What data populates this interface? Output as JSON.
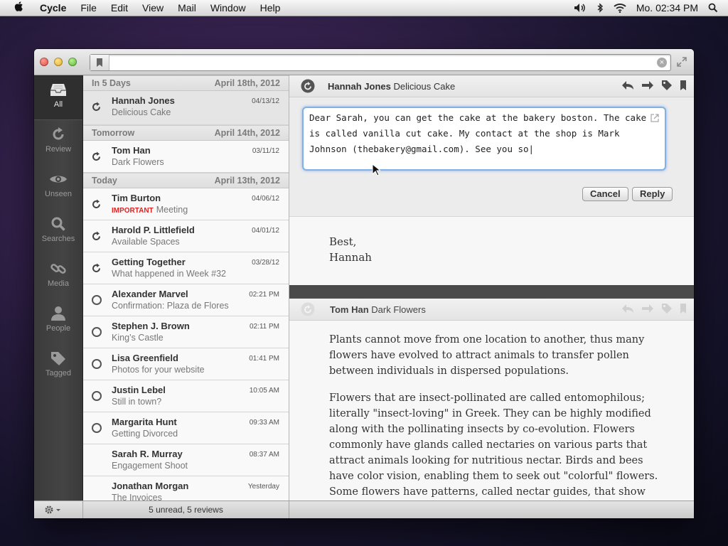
{
  "menubar": {
    "app": "Cycle",
    "items": [
      "File",
      "Edit",
      "View",
      "Mail",
      "Window",
      "Help"
    ],
    "clock": "Mo. 02:34 PM"
  },
  "sidebar": {
    "items": [
      {
        "label": "All",
        "icon": "inbox-icon"
      },
      {
        "label": "Review",
        "icon": "refresh-icon"
      },
      {
        "label": "Unseen",
        "icon": "eye-icon"
      },
      {
        "label": "Searches",
        "icon": "search-icon"
      },
      {
        "label": "Media",
        "icon": "link-icon"
      },
      {
        "label": "People",
        "icon": "person-icon"
      },
      {
        "label": "Tagged",
        "icon": "tag-icon"
      }
    ]
  },
  "list": {
    "groups": [
      {
        "label": "In 5 Days",
        "date": "April 18th, 2012"
      },
      {
        "label": "Tomorrow",
        "date": "April 14th, 2012"
      },
      {
        "label": "Today",
        "date": "April 13th, 2012"
      }
    ],
    "rows": [
      {
        "name": "Hannah Jones",
        "subject": "Delicious Cake",
        "date": "04/13/12"
      },
      {
        "name": "Tom Han",
        "subject": "Dark Flowers",
        "date": "03/11/12"
      },
      {
        "name": "Tim Burton",
        "important": "IMPORTANT",
        "subject": "Meeting",
        "date": "04/06/12"
      },
      {
        "name": "Harold P. Littlefield",
        "subject": "Available Spaces",
        "date": "04/01/12"
      },
      {
        "name": "Getting Together",
        "subject": "What happened in Week #32",
        "date": "03/28/12"
      },
      {
        "name": "Alexander Marvel",
        "subject": "Confirmation: Plaza de Flores",
        "date": "02:21 PM"
      },
      {
        "name": "Stephen J. Brown",
        "subject": "King’s Castle",
        "date": "02:11 PM"
      },
      {
        "name": "Lisa Greenfield",
        "subject": "Photos for your website",
        "date": "01:41 PM"
      },
      {
        "name": "Justin Lebel",
        "subject": "Still in town?",
        "date": "10:05 AM"
      },
      {
        "name": "Margarita Hunt",
        "subject": "Getting Divorced",
        "date": "09:33 AM"
      },
      {
        "name": "Sarah R. Murray",
        "subject": "Engagement Shoot",
        "date": "08:37 AM"
      },
      {
        "name": "Jonathan Morgan",
        "subject": "The Invoices",
        "date": "Yesterday"
      }
    ]
  },
  "message1": {
    "sender": "Hannah Jones",
    "subject": "Delicious Cake",
    "reply_text": "Dear Sarah, you can get the cake at the bakery boston. The cake is called vanilla cut cake. My contact at the shop is Mark Johnson (thebakery@gmail.com). See you so|",
    "cancel": "Cancel",
    "reply": "Reply",
    "body_line1": "Best,",
    "body_line2": "Hannah"
  },
  "message2": {
    "sender": "Tom Han",
    "subject": "Dark Flowers",
    "para1": "Plants cannot move from one location to another, thus many flowers have evolved to attract animals to transfer pollen between individuals in dispersed populations.",
    "para2": "Flowers that are insect-pollinated are called entomophilous; literally \"insect-loving\" in Greek. They can be highly modified along with the pollinating insects by co-evolution. Flowers commonly have glands called nectaries on various parts that attract animals looking for nutritious nectar. Birds and bees have color vision, enabling them to seek out \"colorful\" flowers. Some flowers have patterns, called nectar guides, that show pollinators"
  },
  "status": {
    "count": "5 unread, 5 reviews"
  },
  "colors": {
    "accent": "#7fb0e8",
    "important": "#dd2222",
    "sidebar": "#404040"
  }
}
